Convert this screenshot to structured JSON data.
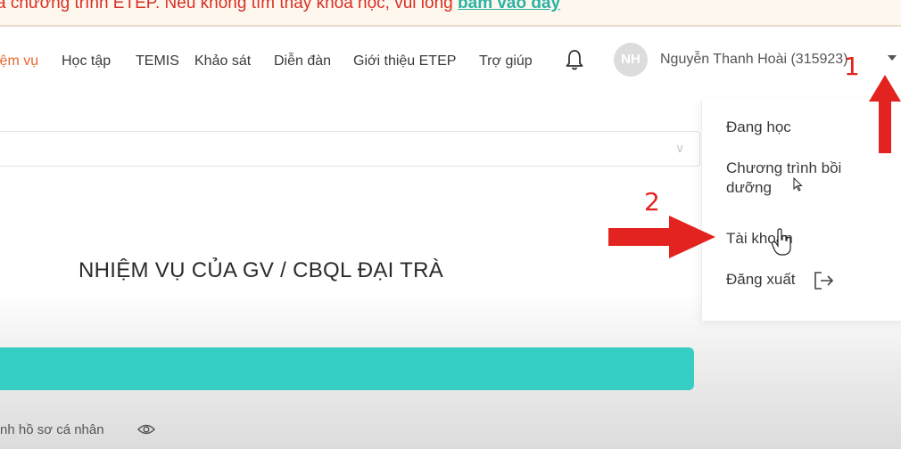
{
  "banner": {
    "text": "a chương trình ETEP. Nếu không tìm thấy khóa học, vui lòng",
    "link": "bấm vào đây"
  },
  "nav": {
    "items": [
      {
        "label": "iệm vụ",
        "active": true
      },
      {
        "label": "Học tập",
        "active": false
      },
      {
        "label": "TEMIS",
        "active": false
      },
      {
        "label": "Khảo sát",
        "active": false
      },
      {
        "label": "Diễn đàn",
        "active": false
      },
      {
        "label": "Giới thiệu ETEP",
        "active": false
      },
      {
        "label": "Trợ giúp",
        "active": false
      }
    ],
    "avatar_initials": "NH",
    "username": "Nguyễn Thanh Hoài (315923)"
  },
  "main": {
    "title": "NHIỆM VỤ CỦA GV / CBQL ĐẠI TRÀ",
    "profile_link": "nh hồ sơ cá nhân"
  },
  "dropdown": {
    "items": [
      {
        "label": "Đang học"
      },
      {
        "label": "Chương trình bồi dưỡng"
      },
      {
        "label": "Tài khoản"
      },
      {
        "label": "Đăng xuất"
      }
    ]
  },
  "annotations": {
    "step1": "1",
    "step2": "2"
  },
  "colors": {
    "accent_orange": "#e8662d",
    "teal": "#36cdc2",
    "annotation_red": "#e3231f",
    "banner_red": "#d93025"
  }
}
